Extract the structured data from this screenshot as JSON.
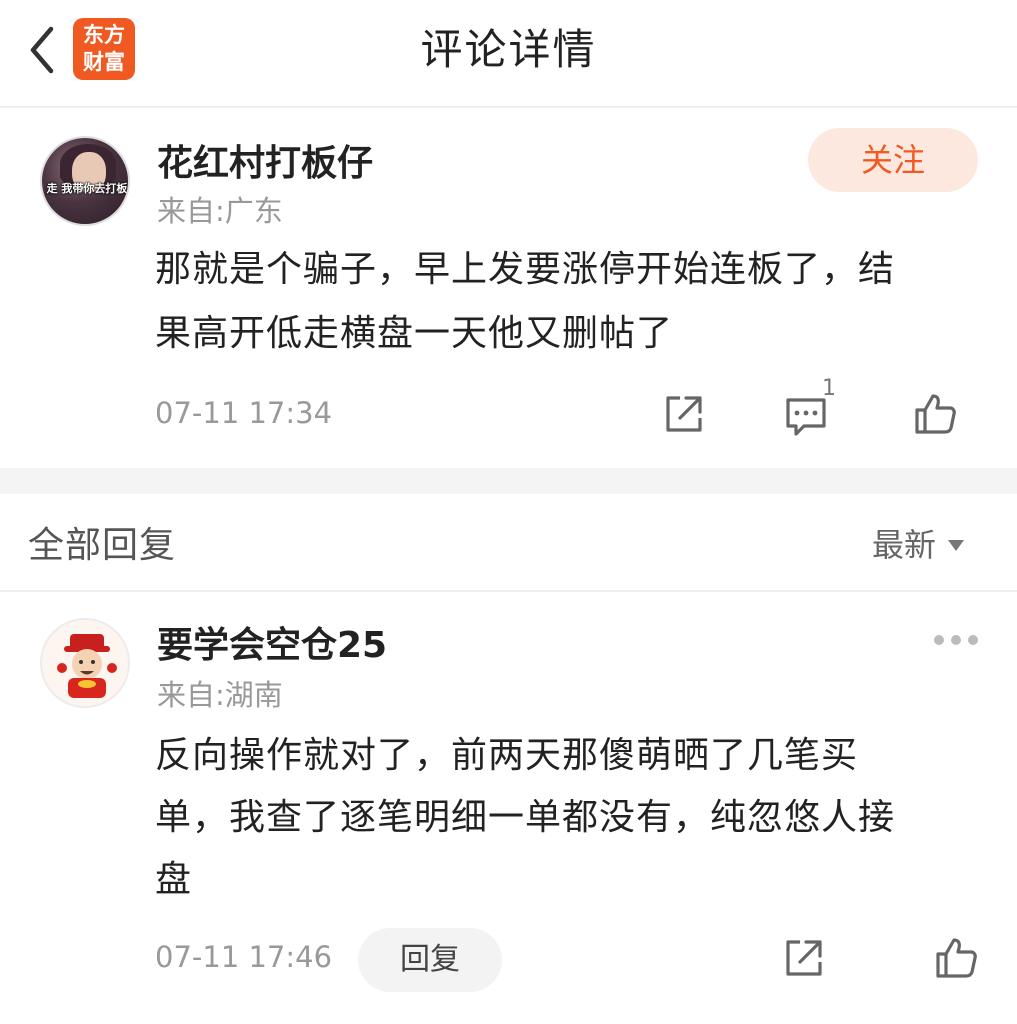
{
  "header": {
    "title": "评论详情",
    "logo_line1": "东方",
    "logo_line2": "财富"
  },
  "colors": {
    "brand": "#f05a22",
    "follow_bg": "#fde8df",
    "muted_text": "#999999"
  },
  "main_comment": {
    "avatar_overlay_text": "走 我带你去打板",
    "username": "花红村打板仔",
    "location": "来自:广东",
    "follow_label": "关注",
    "content_line1": "那就是个骗子，早上发要涨停开始连板了，结",
    "content_line2": "果高开低走横盘一天他又删帖了",
    "timestamp": "07-11 17:34",
    "reply_count": "1",
    "icons": [
      "share-icon",
      "comment-icon",
      "like-icon"
    ]
  },
  "replies": {
    "title": "全部回复",
    "sort_label": "最新",
    "items": [
      {
        "username": "要学会空仓25",
        "location": "来自:湖南",
        "content_line1": "反向操作就对了，前两天那傻萌晒了几笔买",
        "content_line2": "单，我查了逐笔明细一单都没有，纯忽悠人接",
        "content_line3": "盘",
        "timestamp": "07-11 17:46",
        "reply_label": "回复",
        "icons": [
          "more-icon",
          "share-icon",
          "like-icon"
        ]
      }
    ]
  }
}
